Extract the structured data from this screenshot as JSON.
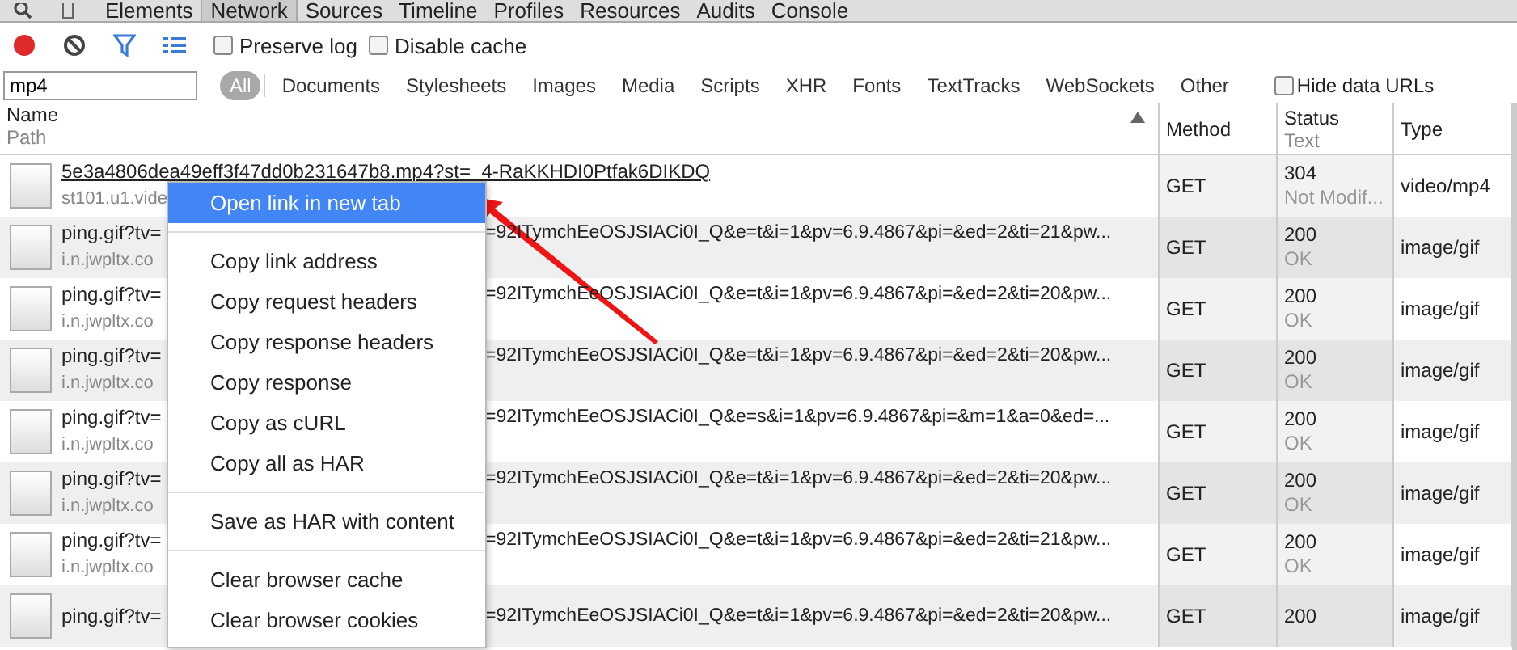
{
  "tabs": [
    {
      "label": "Elements",
      "selected": false
    },
    {
      "label": "Network",
      "selected": true
    },
    {
      "label": "Sources",
      "selected": false
    },
    {
      "label": "Timeline",
      "selected": false
    },
    {
      "label": "Profiles",
      "selected": false
    },
    {
      "label": "Resources",
      "selected": false
    },
    {
      "label": "Audits",
      "selected": false
    },
    {
      "label": "Console",
      "selected": false
    }
  ],
  "toolbar": {
    "options": [
      {
        "label": "Preserve log",
        "checked": false
      },
      {
        "label": "Disable cache",
        "checked": false
      }
    ]
  },
  "filter": {
    "value": "mp4",
    "types": [
      {
        "label": "All",
        "selected": true
      },
      {
        "label": "Documents",
        "selected": false
      },
      {
        "label": "Stylesheets",
        "selected": false
      },
      {
        "label": "Images",
        "selected": false
      },
      {
        "label": "Media",
        "selected": false
      },
      {
        "label": "Scripts",
        "selected": false
      },
      {
        "label": "XHR",
        "selected": false
      },
      {
        "label": "Fonts",
        "selected": false
      },
      {
        "label": "TextTracks",
        "selected": false
      },
      {
        "label": "WebSockets",
        "selected": false
      },
      {
        "label": "Other",
        "selected": false
      }
    ],
    "hide_data_urls": {
      "label": "Hide data URLs",
      "checked": false
    }
  },
  "table": {
    "columns": [
      {
        "title": "Name",
        "subtitle": "Path"
      },
      {
        "title": "Method"
      },
      {
        "title": "Status",
        "subtitle": "Text"
      },
      {
        "title": "Type"
      }
    ],
    "rows": [
      {
        "name": "5e3a4806dea49eff3f47dd0b231647b8.mp4?st=_4-RaKKHDI0Ptfak6DIKDQ",
        "hovered": true,
        "path": "st101.u1.vide",
        "method": "GET",
        "status": "304",
        "status_text": "Not Modif...",
        "type": "video/mp4"
      },
      {
        "name": "ping.gif?tv=",
        "name_end": "=92ITymchEeOSJSIACi0I_Q&e=t&i=1&pv=6.9.4867&pi=&ed=2&ti=21&pw...",
        "hovered": false,
        "path": "i.n.jwpltx.co",
        "method": "GET",
        "status": "200",
        "status_text": "OK",
        "type": "image/gif"
      },
      {
        "name": "ping.gif?tv=",
        "name_end": "=92ITymchEeOSJSIACi0I_Q&e=t&i=1&pv=6.9.4867&pi=&ed=2&ti=20&pw...",
        "hovered": false,
        "path": "i.n.jwpltx.co",
        "method": "GET",
        "status": "200",
        "status_text": "OK",
        "type": "image/gif"
      },
      {
        "name": "ping.gif?tv=",
        "name_end": "=92ITymchEeOSJSIACi0I_Q&e=t&i=1&pv=6.9.4867&pi=&ed=2&ti=20&pw...",
        "hovered": false,
        "path": "i.n.jwpltx.co",
        "method": "GET",
        "status": "200",
        "status_text": "OK",
        "type": "image/gif"
      },
      {
        "name": "ping.gif?tv=",
        "name_end": "=92ITymchEeOSJSIACi0I_Q&e=s&i=1&pv=6.9.4867&pi=&m=1&a=0&ed=...",
        "hovered": false,
        "path": "i.n.jwpltx.co",
        "method": "GET",
        "status": "200",
        "status_text": "OK",
        "type": "image/gif"
      },
      {
        "name": "ping.gif?tv=",
        "name_end": "=92ITymchEeOSJSIACi0I_Q&e=t&i=1&pv=6.9.4867&pi=&ed=2&ti=20&pw...",
        "hovered": false,
        "path": "i.n.jwpltx.co",
        "method": "GET",
        "status": "200",
        "status_text": "OK",
        "type": "image/gif"
      },
      {
        "name": "ping.gif?tv=",
        "name_end": "=92ITymchEeOSJSIACi0I_Q&e=t&i=1&pv=6.9.4867&pi=&ed=2&ti=21&pw...",
        "hovered": false,
        "path": "i.n.jwpltx.co",
        "method": "GET",
        "status": "200",
        "status_text": "OK",
        "type": "image/gif"
      },
      {
        "name": "ping.gif?tv=",
        "name_end": "=92ITymchEeOSJSIACi0I_Q&e=t&i=1&pv=6.9.4867&pi=&ed=2&ti=20&pw...",
        "hovered": false,
        "method": "GET",
        "status": "200",
        "type": "image/gif"
      }
    ]
  },
  "context_menu": {
    "groups": [
      [
        {
          "label": "Open link in new tab",
          "selected": true
        }
      ],
      [
        {
          "label": "Copy link address",
          "selected": false
        },
        {
          "label": "Copy request headers",
          "selected": false
        },
        {
          "label": "Copy response headers",
          "selected": false
        },
        {
          "label": "Copy response",
          "selected": false
        },
        {
          "label": "Copy as cURL",
          "selected": false
        },
        {
          "label": "Copy all as HAR",
          "selected": false
        }
      ],
      [
        {
          "label": "Save as HAR with content",
          "selected": false
        }
      ],
      [
        {
          "label": "Clear browser cache",
          "selected": false
        },
        {
          "label": "Clear browser cookies",
          "selected": false
        }
      ]
    ]
  }
}
